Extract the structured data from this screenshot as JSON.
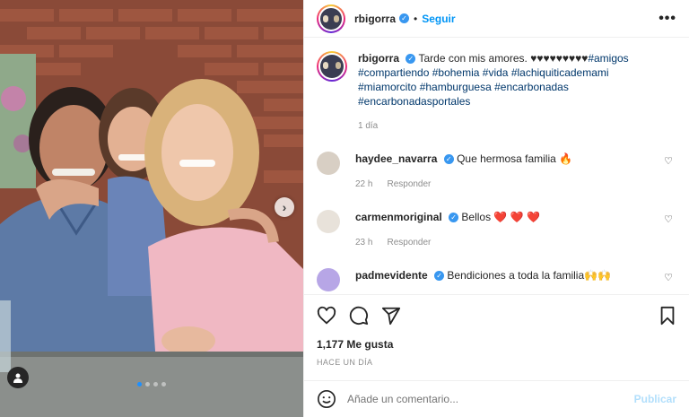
{
  "post": {
    "username": "rbigorra",
    "follow_label": "Seguir",
    "separator": "•",
    "more_label": "•••",
    "caption_text": "Tarde con mis amores. ♥♥♥♥♥♥♥♥♥",
    "hashtags": [
      "#amigos",
      "#compartiendo",
      "#bohemia",
      "#vida",
      "#lachiquiticademami",
      "#miamorcito",
      "#hamburguesa",
      "#encarbonadas",
      "#encarbonadasportales"
    ],
    "caption_time": "1 día",
    "likes": "1,177 Me gusta",
    "time_ago": "HACE UN DÍA"
  },
  "comments": [
    {
      "username": "haydee_navarra",
      "text": "Que hermosa familia 🔥",
      "time": "22 h",
      "reply": "Responder",
      "avatar_color": "#d8cfc4"
    },
    {
      "username": "carmenmoriginal",
      "text": "Bellos ❤️ ❤️ ❤️",
      "time": "23 h",
      "reply": "Responder",
      "avatar_color": "#e8e2da"
    },
    {
      "username": "padmevidente",
      "text": "Bendiciones a toda la familia🙌🙌",
      "time": "",
      "reply": "",
      "avatar_color": "#b7a6e6"
    }
  ],
  "add_comment": {
    "placeholder": "Añade un comentario...",
    "publish_label": "Publicar"
  },
  "carousel": {
    "next_label": "›",
    "slide_count": 4,
    "active_slide": 1
  },
  "icons": {
    "like": "heart-icon",
    "comment": "comment-icon",
    "share": "share-icon",
    "save": "bookmark-icon",
    "emoji": "emoji-icon",
    "tag": "user-tag-icon"
  },
  "colors": {
    "accent": "#0095f6",
    "verified": "#3897f0",
    "hashtag": "#00376b",
    "muted": "#8e8e8e"
  }
}
